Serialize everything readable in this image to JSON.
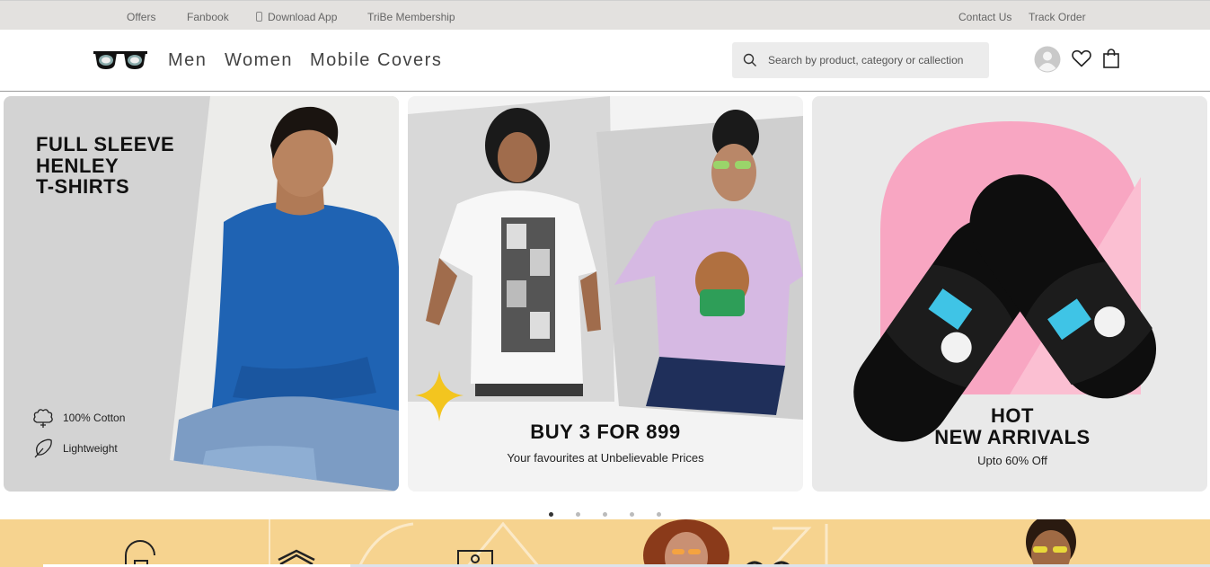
{
  "topbar": {
    "offers": "Offers",
    "fanbook": "Fanbook",
    "download_app": "Download App",
    "tribe": "TriBe Membership",
    "contact": "Contact Us",
    "track": "Track Order"
  },
  "nav": {
    "men": "Men",
    "women": "Women",
    "mobile_covers": "Mobile Covers"
  },
  "search": {
    "placeholder": "Search by product, category or callection"
  },
  "banners": {
    "b1": {
      "title_line1": "FULL SLEEVE",
      "title_line2": "HENLEY",
      "title_line3": "T-SHIRTS",
      "feature1": "100% Cotton",
      "feature2": "Lightweight"
    },
    "b2": {
      "title": "BUY 3 FOR 899",
      "subtitle": "Your favourites at Unbelievable Prices"
    },
    "b3": {
      "title_line1": "HOT",
      "title_line2": "NEW ARRIVALS",
      "subtitle": "Upto 60% Off"
    }
  },
  "carousel": {
    "count": 5,
    "active": 1
  },
  "colors": {
    "topbar_bg": "#e3e1df",
    "strip_bg": "#f6d38f",
    "pink": "#f9a9c3",
    "tshirt_blue": "#1f63b3"
  },
  "icons": [
    "sunglasses-logo",
    "search-icon",
    "user-icon",
    "heart-icon",
    "bag-icon",
    "cotton-icon",
    "feather-icon",
    "phone-icon",
    "sparkle-icon"
  ]
}
